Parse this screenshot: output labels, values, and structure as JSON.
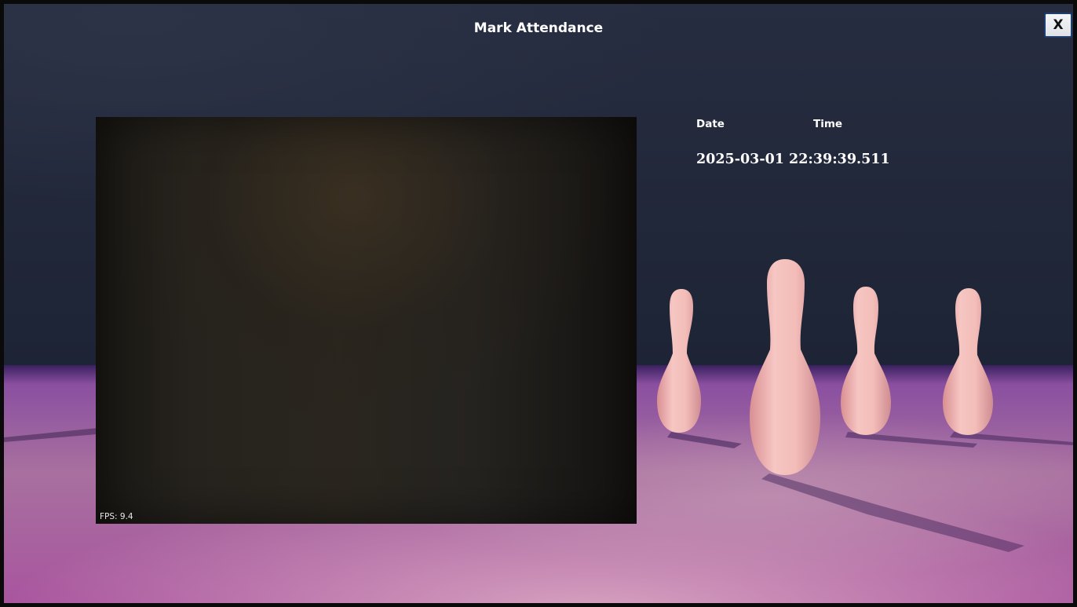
{
  "window": {
    "title": "Mark Attendance",
    "close_label": "X"
  },
  "camera": {
    "fps_text": "FPS: 9.4"
  },
  "info": {
    "date_label": "Date",
    "time_label": "Time",
    "datetime_value": "2025-03-01 22:39:39.511"
  },
  "colors": {
    "backdrop_top": "#232a3d",
    "floor": "#b07fb0",
    "pin": "#f0b8b4"
  }
}
